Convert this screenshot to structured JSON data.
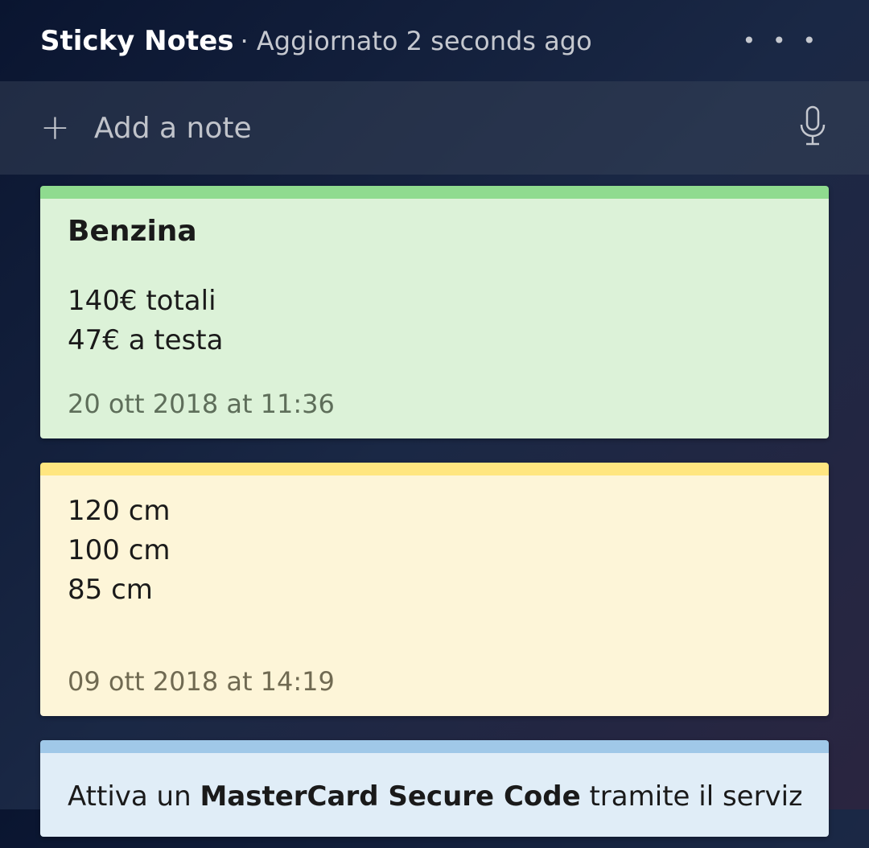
{
  "header": {
    "title": "Sticky Notes",
    "status": "· Aggiornato 2 seconds ago"
  },
  "addBar": {
    "placeholder": "Add a note"
  },
  "notes": [
    {
      "color": "green",
      "title": "Benzina",
      "lines": [
        "140€ totali",
        "47€ a testa"
      ],
      "timestamp": "20 ott 2018 at 11:36"
    },
    {
      "color": "yellow",
      "title": "",
      "lines": [
        "120 cm",
        "100 cm",
        "85 cm"
      ],
      "timestamp": "09 ott 2018 at 14:19"
    },
    {
      "color": "blue",
      "partial_prefix": "Attiva un ",
      "partial_bold": "MasterCard Secure Code",
      "partial_suffix": " tramite il servizio"
    }
  ]
}
